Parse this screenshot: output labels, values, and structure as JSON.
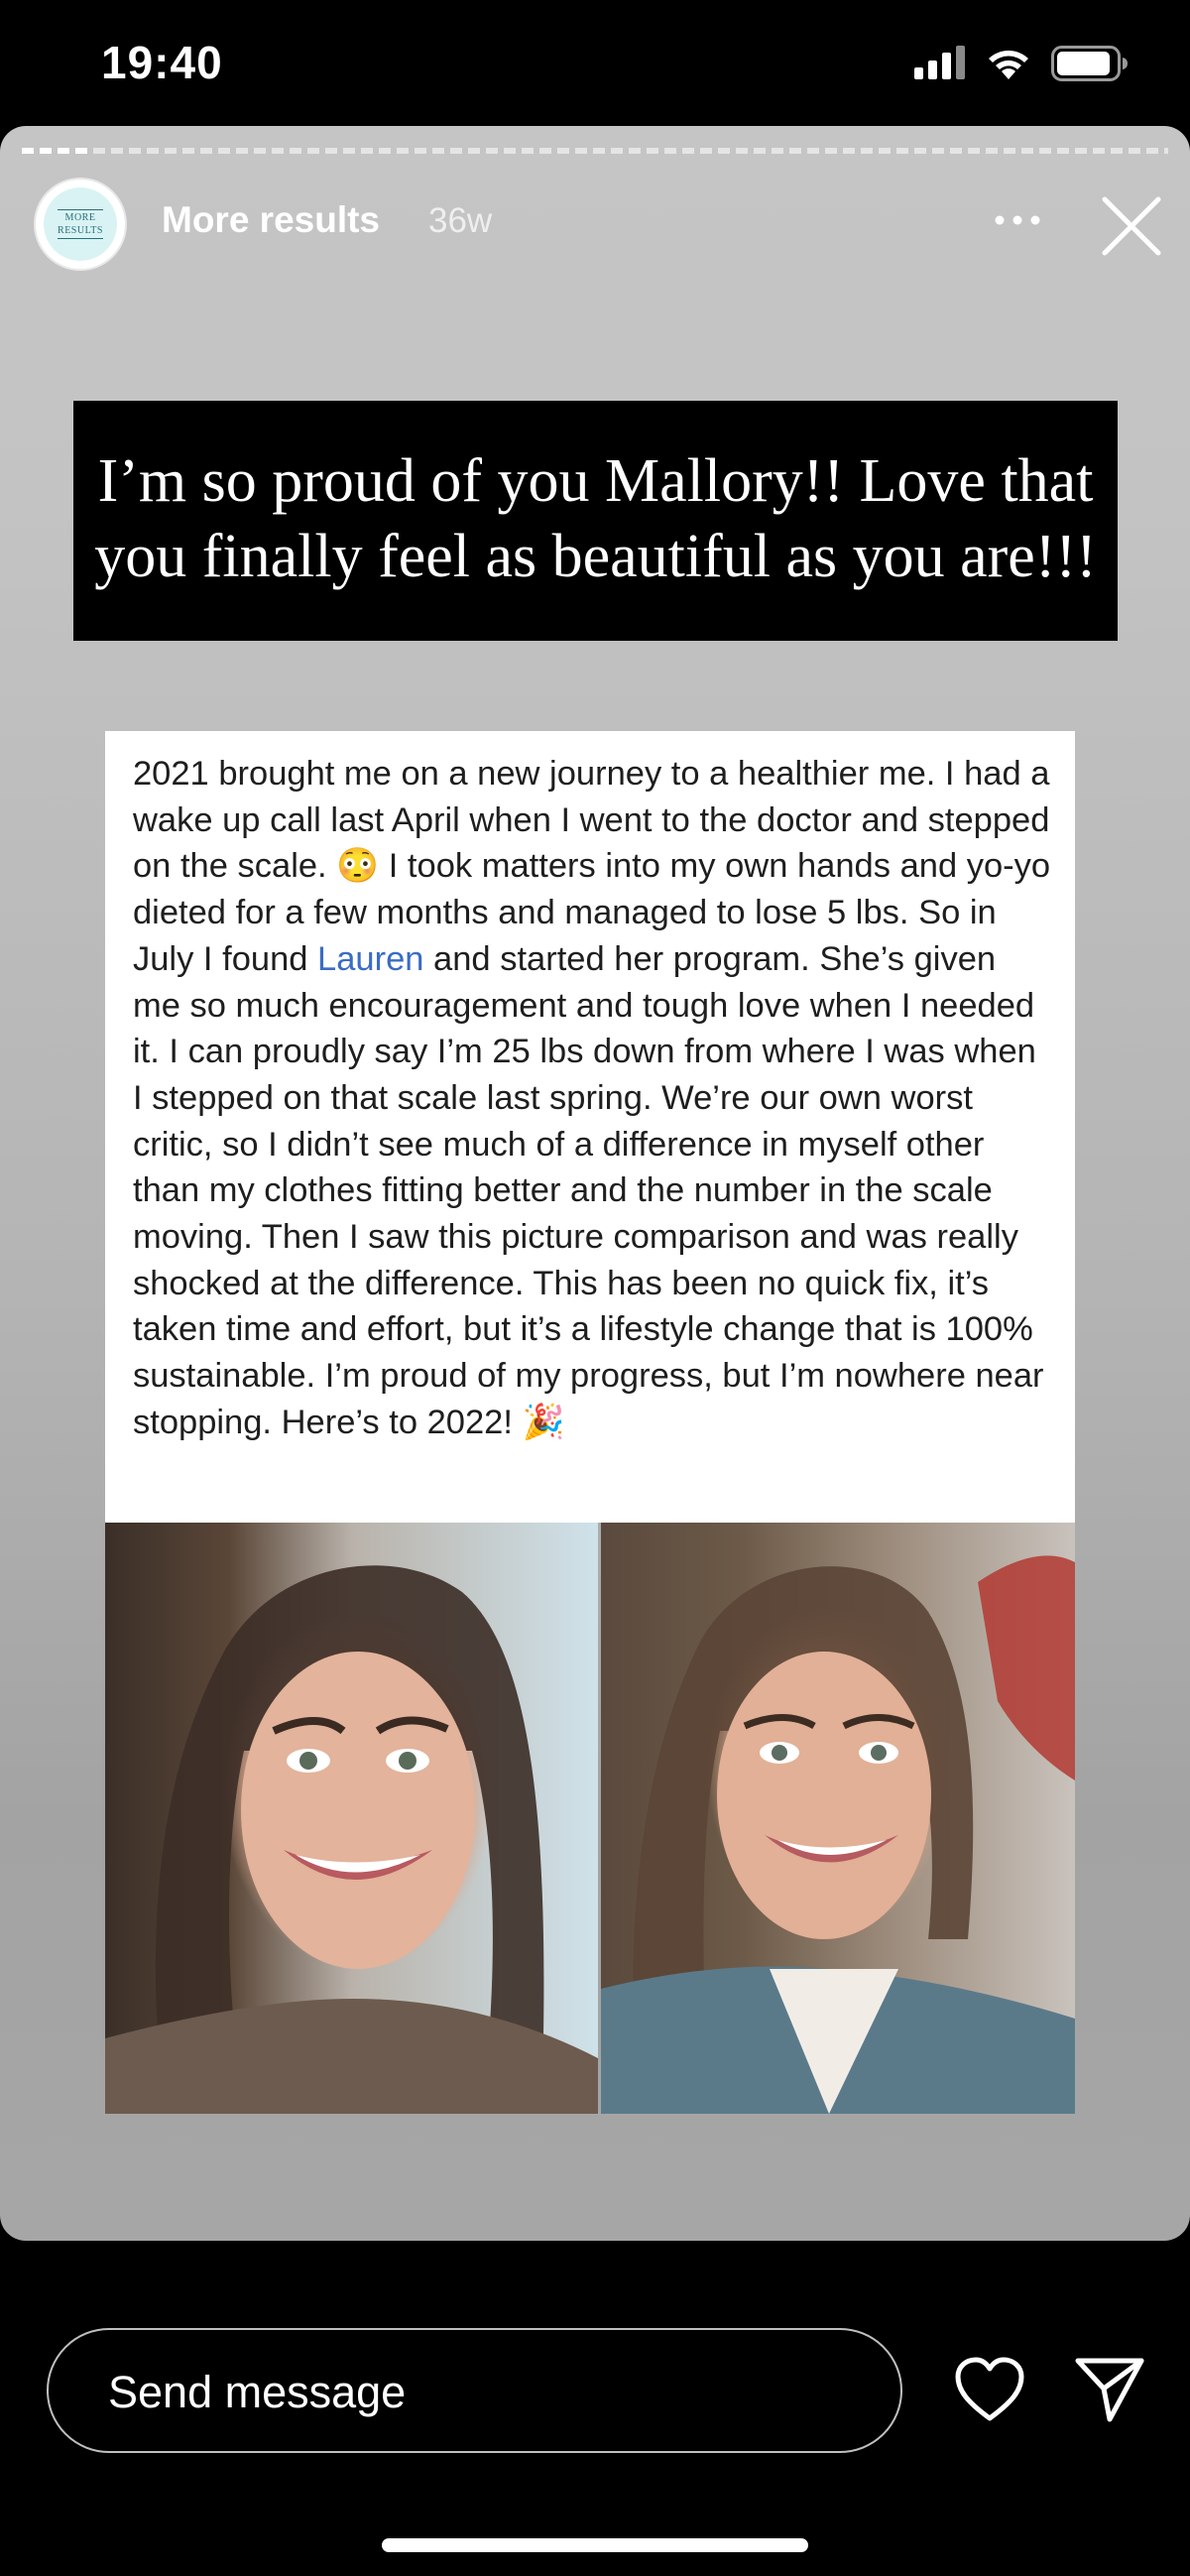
{
  "status_bar": {
    "time": "19:40",
    "signal_icon": "cellular-signal-icon",
    "wifi_icon": "wifi-icon",
    "battery_icon": "battery-icon"
  },
  "story": {
    "progress": 0.06,
    "avatar": {
      "line1": "MORE",
      "line2": "RESULTS"
    },
    "username": "More results",
    "time_ago": "36w",
    "more_icon": "more-options-icon",
    "close_icon": "close-icon",
    "caption": "I’m so proud of you Mallory!! Love that you finally feel as beautiful as you are!!!",
    "post": {
      "text_before_link": "2021 brought me on a new journey to a healthier me. I had a wake up call last April when I went to the doctor and stepped on the scale. 😳 I took matters into my own hands and yo-yo dieted for a few months and managed to lose 5 lbs. So in July I found ",
      "link_text": "Lauren",
      "text_after_link": " and started her program. She’s given me so much encouragement and tough love when I needed it. I can proudly say I’m 25 lbs down from where I was when I stepped on that scale last spring. We’re our own worst critic, so I didn’t see much of a difference in myself other than my clothes fitting better and the number in the scale moving. Then I saw this picture comparison and was really shocked at the difference. This has been no quick fix, it’s taken time and effort, but it’s a lifestyle change that is 100% sustainable. I’m proud of my progress, but I’m nowhere near stopping. Here’s to 2022! 🎉"
    },
    "photos": {
      "before": "before-photo",
      "after": "after-photo"
    }
  },
  "footer": {
    "message_placeholder": "Send message",
    "like_icon": "heart-icon",
    "share_icon": "paper-plane-icon"
  },
  "colors": {
    "background": "#000000",
    "link": "#3a6cc5",
    "caption_bg": "#000000"
  }
}
